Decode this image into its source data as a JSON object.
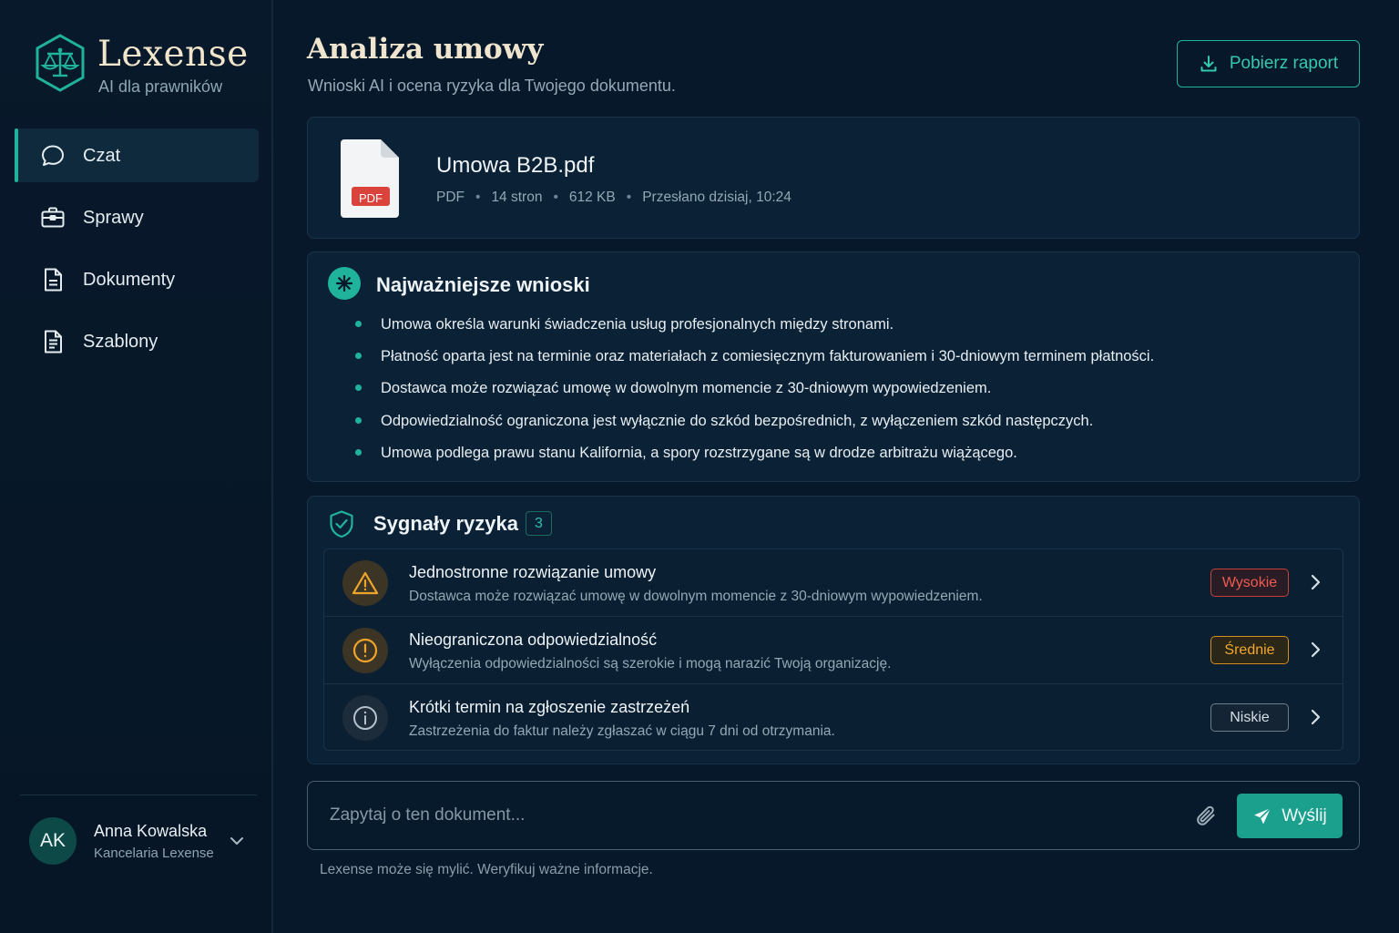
{
  "brand": {
    "name": "Lexense",
    "tagline": "AI dla prawników",
    "logo_icon": "scales-icon"
  },
  "sidebar": {
    "items": [
      {
        "label": "Czat",
        "icon": "chat-bubble-icon",
        "active": true
      },
      {
        "label": "Sprawy",
        "icon": "briefcase-icon",
        "active": false
      },
      {
        "label": "Dokumenty",
        "icon": "document-icon",
        "active": false
      },
      {
        "label": "Szablony",
        "icon": "template-icon",
        "active": false
      }
    ]
  },
  "user": {
    "initials": "AK",
    "name": "Anna Kowalska",
    "org": "Kancelaria Lexense"
  },
  "header": {
    "title": "Analiza umowy",
    "subtitle": "Wnioski AI i ocena ryzyka dla Twojego dokumentu.",
    "download_label": "Pobierz raport"
  },
  "file": {
    "name": "Umowa B2B.pdf",
    "icon_label": "PDF",
    "type": "PDF",
    "pages": "14 stron",
    "size": "612 KB",
    "uploaded": "Przesłano dzisiaj, 10:24"
  },
  "insights": {
    "title": "Najważniejsze wnioski",
    "items": [
      "Umowa określa warunki świadczenia usług profesjonalnych między stronami.",
      "Płatność oparta jest na terminie oraz materiałach z comiesięcznym fakturowaniem i 30-dniowym terminem płatności.",
      "Dostawca może rozwiązać umowę w dowolnym momencie z 30-dniowym wypowiedzeniem.",
      "Odpowiedzialność ograniczona jest wyłącznie do szkód bezpośrednich, z wyłączeniem szkód następczych.",
      "Umowa podlega prawu stanu Kalifornia, a spory rozstrzygane są w drodze arbitrażu wiążącego."
    ]
  },
  "risks": {
    "title": "Sygnały ryzyka",
    "count": "3",
    "items": [
      {
        "title": "Jednostronne rozwiązanie umowy",
        "desc": "Dostawca może rozwiązać umowę w dowolnym momencie z 30-dniowym wypowiedzeniem.",
        "level": "Wysokie",
        "icon": "warning-triangle-icon",
        "color": "#e0463f"
      },
      {
        "title": "Nieograniczona odpowiedzialność",
        "desc": "Wyłączenia odpowiedzialności są szerokie i mogą narazić Twoją organizację.",
        "level": "Średnie",
        "icon": "exclamation-circle-icon",
        "color": "#e9a12a"
      },
      {
        "title": "Krótki termin na zgłoszenie zastrzeżeń",
        "desc": "Zastrzeżenia do faktur należy zgłaszać w ciągu 7 dni od otrzymania.",
        "level": "Niskie",
        "icon": "info-circle-icon",
        "color": "#9aa9b4"
      }
    ]
  },
  "chat": {
    "placeholder": "Zapytaj o ten dokument...",
    "send_label": "Wyślij",
    "disclaimer": "Lexense może się mylić. Weryfikuj ważne informacje."
  },
  "colors": {
    "accent": "#1fb39c",
    "background": "#07182a",
    "card": "#0b2135",
    "brand_text": "#f1e6cc"
  }
}
